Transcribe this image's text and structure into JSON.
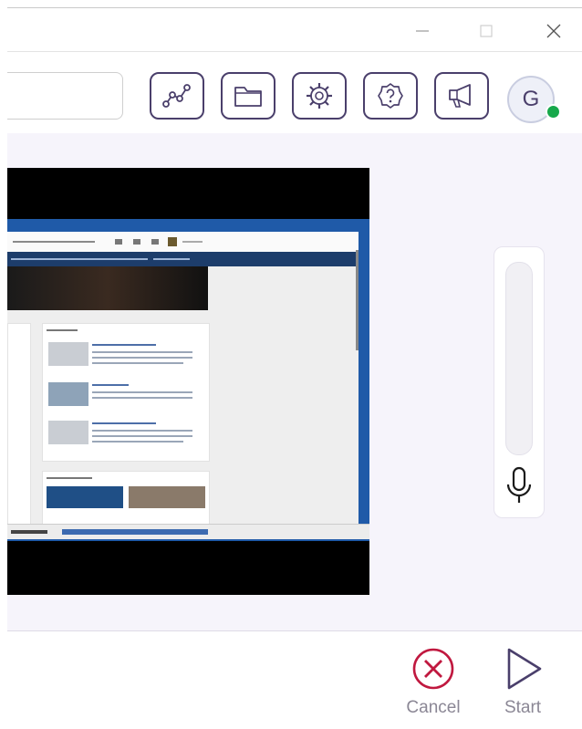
{
  "window": {
    "buttons": [
      {
        "name": "minimize",
        "icon": "minimize-icon"
      },
      {
        "name": "maximize",
        "icon": "maximize-icon"
      },
      {
        "name": "close",
        "icon": "close-icon"
      }
    ]
  },
  "toolbar": {
    "search": {
      "value": "",
      "placeholder": ""
    },
    "buttons": [
      {
        "name": "analytics-button",
        "icon": "line-chart-icon"
      },
      {
        "name": "folder-button",
        "icon": "folder-icon"
      },
      {
        "name": "settings-button",
        "icon": "gear-icon"
      },
      {
        "name": "help-button",
        "icon": "help-icon"
      },
      {
        "name": "announcements-button",
        "icon": "megaphone-icon"
      }
    ],
    "avatar": {
      "initial": "G",
      "status": "online",
      "status_color": "#17a84b"
    }
  },
  "microphone": {
    "icon": "microphone-icon",
    "level": 0
  },
  "actions": {
    "cancel_label": "Cancel",
    "start_label": "Start",
    "cancel_color": "#c0183f",
    "start_color": "#4a3f6b"
  },
  "colors": {
    "accent": "#4a3f6b",
    "panel_bg": "#f6f4fb"
  }
}
